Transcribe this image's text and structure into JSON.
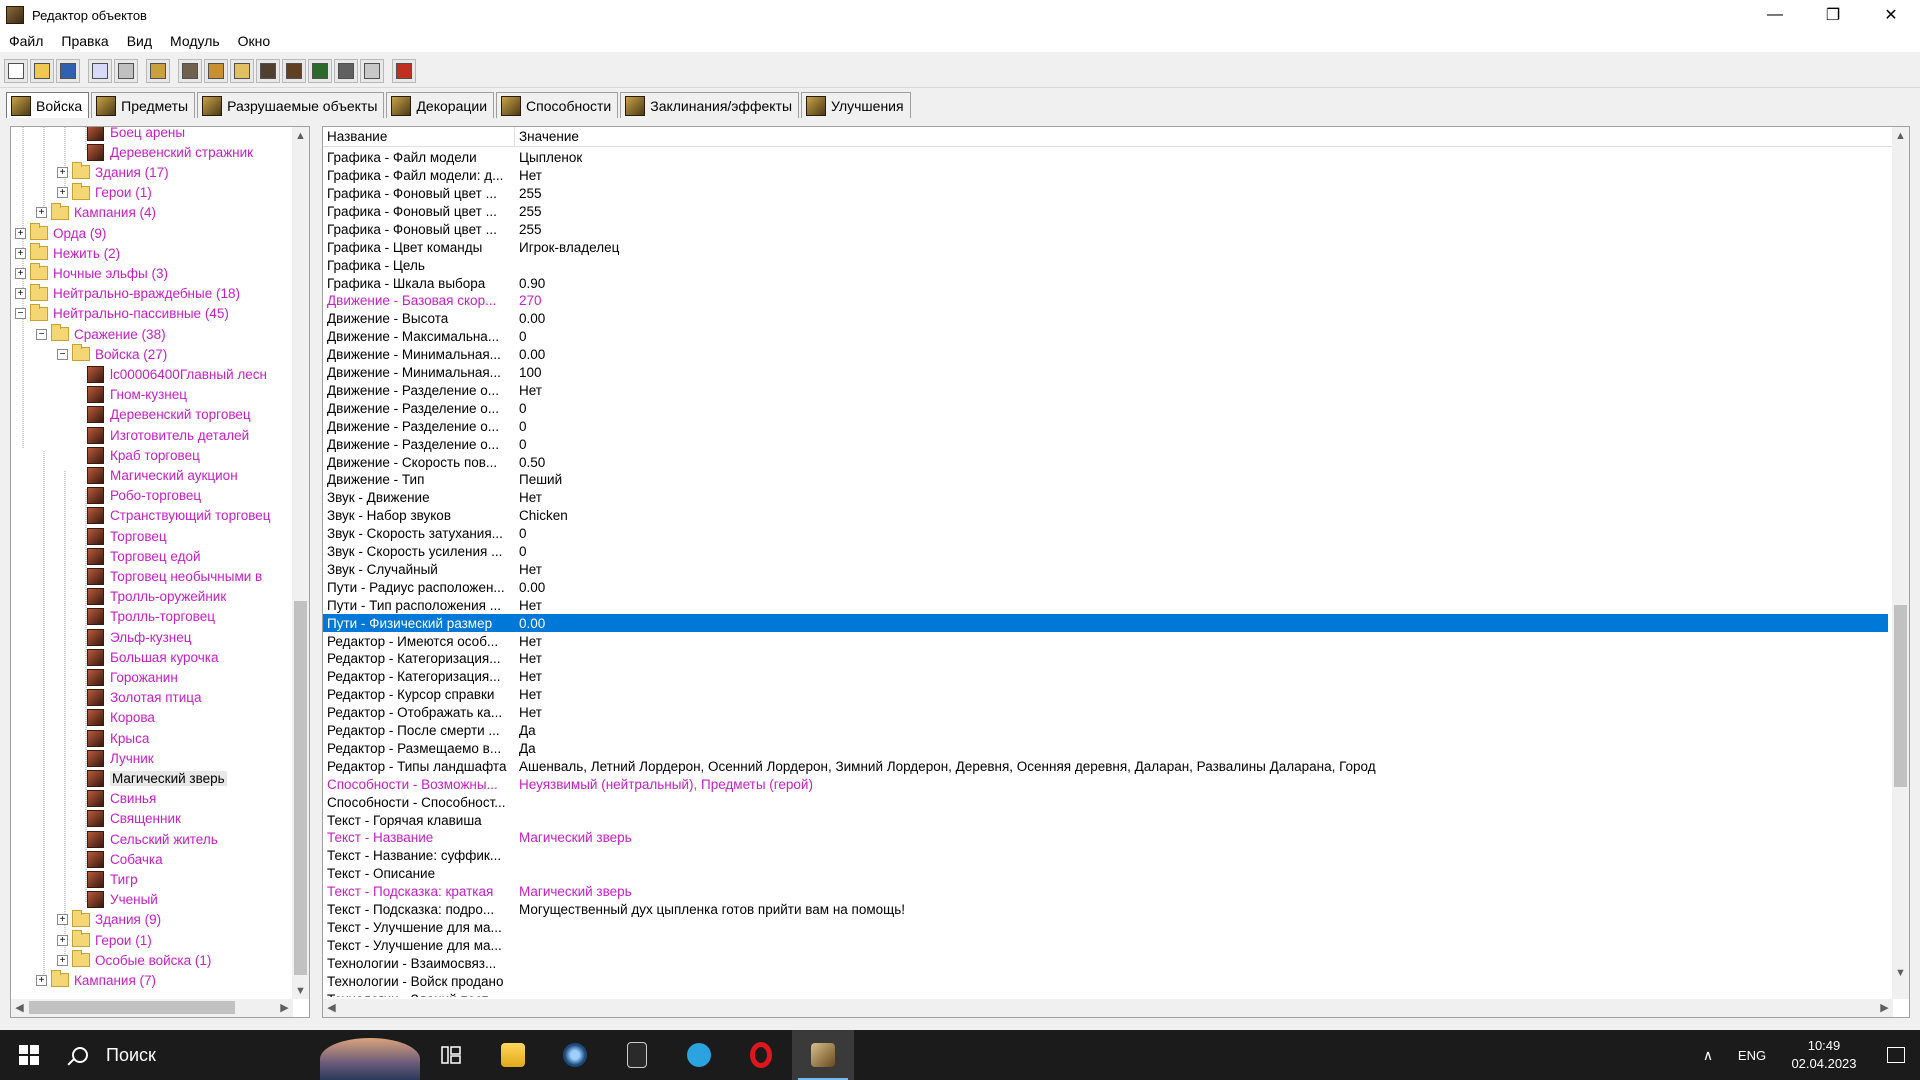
{
  "window": {
    "title": "Редактор объектов",
    "controls": [
      "—",
      "❐",
      "✕"
    ]
  },
  "menu": [
    "Файл",
    "Правка",
    "Вид",
    "Модуль",
    "Окно"
  ],
  "toolbar": {
    "buttons": [
      "new-file-icon",
      "open-file-icon",
      "save-icon",
      "copy-icon",
      "paste-icon",
      "unit-editor-icon",
      "terrain-icon",
      "item-icon",
      "sound-icon",
      "unit-icon",
      "import-icon",
      "map-icon",
      "doodad-icon",
      "export-icon",
      "test-map-icon"
    ]
  },
  "tabs": [
    {
      "label": "Войска",
      "active": true
    },
    {
      "label": "Предметы",
      "active": false
    },
    {
      "label": "Разрушаемые объекты",
      "active": false
    },
    {
      "label": "Декорации",
      "active": false
    },
    {
      "label": "Способности",
      "active": false
    },
    {
      "label": "Заклинания/эффекты",
      "active": false
    },
    {
      "label": "Улучшения",
      "active": false
    }
  ],
  "tree": {
    "rows": [
      {
        "level": 4,
        "type": "unit",
        "label": "Боец арены"
      },
      {
        "level": 4,
        "type": "unit",
        "label": "Деревенский стражник"
      },
      {
        "level": 2,
        "type": "folder",
        "expander": "+",
        "label": "Здания (17)"
      },
      {
        "level": 2,
        "type": "folder",
        "expander": "+",
        "label": "Герои (1)"
      },
      {
        "level": 1,
        "type": "folder",
        "expander": "+",
        "label": "Кампания (4)"
      },
      {
        "level": 0,
        "type": "folder",
        "expander": "+",
        "label": "Орда (9)"
      },
      {
        "level": 0,
        "type": "folder",
        "expander": "+",
        "label": "Нежить (2)"
      },
      {
        "level": 0,
        "type": "folder",
        "expander": "+",
        "label": "Ночные эльфы (3)"
      },
      {
        "level": 0,
        "type": "folder",
        "expander": "+",
        "label": "Нейтрально-враждебные (18)"
      },
      {
        "level": 0,
        "type": "folder",
        "expander": "−",
        "label": "Нейтрально-пассивные (45)"
      },
      {
        "level": 1,
        "type": "folder",
        "expander": "−",
        "label": "Сражение (38)"
      },
      {
        "level": 2,
        "type": "folder",
        "expander": "−",
        "label": "Войска (27)"
      },
      {
        "level": 4,
        "type": "unit",
        "label": "lc00006400Главный лесн"
      },
      {
        "level": 4,
        "type": "unit",
        "label": "Гном-кузнец"
      },
      {
        "level": 4,
        "type": "unit",
        "label": "Деревенский торговец"
      },
      {
        "level": 4,
        "type": "unit",
        "label": "Изготовитель деталей"
      },
      {
        "level": 4,
        "type": "unit",
        "label": "Краб торговец"
      },
      {
        "level": 4,
        "type": "unit",
        "label": "Магический аукцион"
      },
      {
        "level": 4,
        "type": "unit",
        "label": "Робо-торговец"
      },
      {
        "level": 4,
        "type": "unit",
        "label": "Странствующий торговец"
      },
      {
        "level": 4,
        "type": "unit",
        "label": "Торговец"
      },
      {
        "level": 4,
        "type": "unit",
        "label": "Торговец едой"
      },
      {
        "level": 4,
        "type": "unit",
        "label": "Торговец необычными в"
      },
      {
        "level": 4,
        "type": "unit",
        "label": "Тролль-оружейник"
      },
      {
        "level": 4,
        "type": "unit",
        "label": "Тролль-торговец"
      },
      {
        "level": 4,
        "type": "unit",
        "label": "Эльф-кузнец"
      },
      {
        "level": 4,
        "type": "unit",
        "label": "Большая курочка"
      },
      {
        "level": 4,
        "type": "unit",
        "label": "Горожанин"
      },
      {
        "level": 4,
        "type": "unit",
        "label": "Золотая птица"
      },
      {
        "level": 4,
        "type": "unit",
        "label": "Корова"
      },
      {
        "level": 4,
        "type": "unit",
        "label": "Крыса"
      },
      {
        "level": 4,
        "type": "unit",
        "label": "Лучник"
      },
      {
        "level": 4,
        "type": "unit",
        "label": "Магический зверь",
        "selected": true,
        "normal": true
      },
      {
        "level": 4,
        "type": "unit",
        "label": "Свинья"
      },
      {
        "level": 4,
        "type": "unit",
        "label": "Священник"
      },
      {
        "level": 4,
        "type": "unit",
        "label": "Сельский житель"
      },
      {
        "level": 4,
        "type": "unit",
        "label": "Собачка"
      },
      {
        "level": 4,
        "type": "unit",
        "label": "Тигр"
      },
      {
        "level": 4,
        "type": "unit",
        "label": "Ученый"
      },
      {
        "level": 2,
        "type": "folder",
        "expander": "+",
        "label": "Здания (9)"
      },
      {
        "level": 2,
        "type": "folder",
        "expander": "+",
        "label": "Герои (1)"
      },
      {
        "level": 2,
        "type": "folder",
        "expander": "+",
        "label": "Особые войска (1)"
      },
      {
        "level": 1,
        "type": "folder",
        "expander": "+",
        "label": "Кампания (7)"
      }
    ]
  },
  "grid": {
    "headers": {
      "name": "Название",
      "value": "Значение"
    },
    "rows": [
      {
        "name": "Графика - Файл модели",
        "value": "Цыпленок"
      },
      {
        "name": "Графика - Файл модели: д...",
        "value": "Нет"
      },
      {
        "name": "Графика - Фоновый цвет ...",
        "value": "255"
      },
      {
        "name": "Графика - Фоновый цвет ...",
        "value": "255"
      },
      {
        "name": "Графика - Фоновый цвет ...",
        "value": "255"
      },
      {
        "name": "Графика - Цвет команды",
        "value": "Игрок-владелец"
      },
      {
        "name": "Графика - Цель",
        "value": ""
      },
      {
        "name": "Графика - Шкала выбора",
        "value": "0.90"
      },
      {
        "name": "Движение - Базовая скор...",
        "value": "270",
        "modified": true
      },
      {
        "name": "Движение - Высота",
        "value": "0.00"
      },
      {
        "name": "Движение - Максимальна...",
        "value": "0"
      },
      {
        "name": "Движение - Минимальная...",
        "value": "0.00"
      },
      {
        "name": "Движение - Минимальная...",
        "value": "100"
      },
      {
        "name": "Движение - Разделение о...",
        "value": "Нет"
      },
      {
        "name": "Движение - Разделение о...",
        "value": "0"
      },
      {
        "name": "Движение - Разделение о...",
        "value": "0"
      },
      {
        "name": "Движение - Разделение о...",
        "value": "0"
      },
      {
        "name": "Движение - Скорость пов...",
        "value": "0.50"
      },
      {
        "name": "Движение - Тип",
        "value": "Пеший"
      },
      {
        "name": "Звук - Движение",
        "value": "Нет"
      },
      {
        "name": "Звук - Набор звуков",
        "value": "Chicken"
      },
      {
        "name": "Звук - Скорость затухания...",
        "value": "0"
      },
      {
        "name": "Звук - Скорость усиления ...",
        "value": "0"
      },
      {
        "name": "Звук - Случайный",
        "value": "Нет"
      },
      {
        "name": "Пути - Радиус расположен...",
        "value": "0.00"
      },
      {
        "name": "Пути - Тип расположения ...",
        "value": "Нет"
      },
      {
        "name": "Пути - Физический размер",
        "value": "0.00",
        "selected": true
      },
      {
        "name": "Редактор - Имеются особ...",
        "value": "Нет"
      },
      {
        "name": "Редактор - Категоризация...",
        "value": "Нет"
      },
      {
        "name": "Редактор - Категоризация...",
        "value": "Нет"
      },
      {
        "name": "Редактор - Курсор справки",
        "value": "Нет"
      },
      {
        "name": "Редактор - Отображать ка...",
        "value": "Нет"
      },
      {
        "name": "Редактор - После смерти ...",
        "value": "Да"
      },
      {
        "name": "Редактор - Размещаемо в...",
        "value": "Да"
      },
      {
        "name": "Редактор - Типы ландшафта",
        "value": "Ашенваль, Летний Лордерон, Осенний Лордерон, Зимний Лордерон, Деревня, Осенняя деревня, Даларан, Развалины Даларана, Город"
      },
      {
        "name": "Способности - Возможны...",
        "value": "Неуязвимый (нейтральный), Предметы (герой)",
        "modified": true
      },
      {
        "name": "Способности - Способност...",
        "value": ""
      },
      {
        "name": "Текст - Горячая клавиша",
        "value": ""
      },
      {
        "name": "Текст - Название",
        "value": "Магический зверь",
        "modified": true
      },
      {
        "name": "Текст - Название: суффик...",
        "value": ""
      },
      {
        "name": "Текст - Описание",
        "value": ""
      },
      {
        "name": "Текст - Подсказка: краткая",
        "value": "Магический зверь",
        "modified": true
      },
      {
        "name": "Текст - Подсказка: подро...",
        "value": "Могущественный дух цыпленка готов прийти вам на помощь!"
      },
      {
        "name": "Текст - Улучшение для ма...",
        "value": ""
      },
      {
        "name": "Текст - Улучшение для ма...",
        "value": ""
      },
      {
        "name": "Технологии - Взаимосвяз...",
        "value": ""
      },
      {
        "name": "Технологии - Войск продано",
        "value": ""
      },
      {
        "name": "Технологии - Зданий пост...",
        "value": ""
      }
    ]
  },
  "taskbar": {
    "search_placeholder": "Поиск",
    "apps": [
      "task-view-icon",
      "file-explorer-icon",
      "steam-icon",
      "epic-games-icon",
      "telegram-icon",
      "opera-icon",
      "warcraft-editor-icon"
    ],
    "lang": "ENG",
    "time": "10:49",
    "date": "02.04.2023"
  },
  "colors": {
    "modified": "#c81ec8",
    "selection": "#0078d7",
    "taskbar": "#1b1b1b"
  }
}
